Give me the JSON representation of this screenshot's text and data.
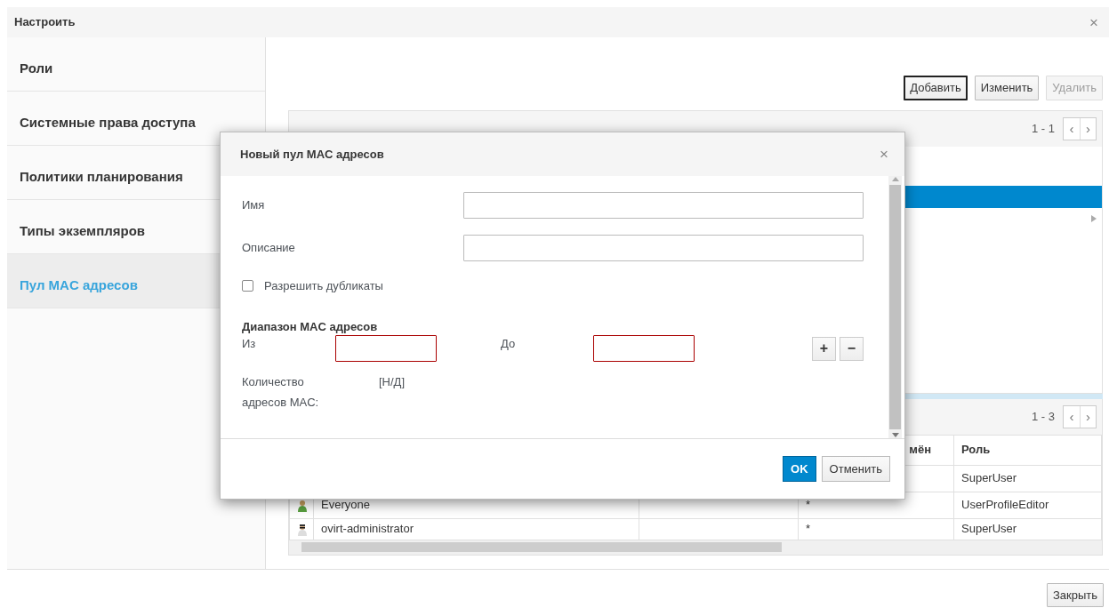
{
  "dialog": {
    "title": "Настроить",
    "close": "×"
  },
  "sidebar": {
    "items": [
      {
        "label": "Роли",
        "selected": false
      },
      {
        "label": "Системные права доступа",
        "selected": false
      },
      {
        "label": "Политики планирования",
        "selected": false
      },
      {
        "label": "Типы экземпляров",
        "selected": false
      },
      {
        "label": "Пул MAC адресов",
        "selected": true
      }
    ]
  },
  "toolbar": {
    "buttons": [
      {
        "label": "Добавить",
        "focused": true,
        "disabled": false
      },
      {
        "label": "Изменить",
        "focused": false,
        "disabled": false
      },
      {
        "label": "Удалить",
        "focused": false,
        "disabled": true
      }
    ]
  },
  "upper_table": {
    "pager": "1 - 1",
    "prev": "‹",
    "next": "›",
    "rows": [
      {
        "selected": true
      }
    ]
  },
  "lower_table": {
    "pager": "1 - 3",
    "prev": "‹",
    "next": "›",
    "columns": [
      "мён",
      "Роль"
    ],
    "rows": [
      {
        "role": "SuperUser"
      },
      {
        "kind": "group",
        "user": "Everyone",
        "column_4": "*",
        "role": "UserProfileEditor"
      },
      {
        "kind": "admin",
        "user": "ovirt-administrator",
        "column_4": "*",
        "role": "SuperUser"
      }
    ]
  },
  "modal": {
    "title": "Новый пул MAC адресов",
    "close": "×",
    "fields": [
      {
        "label": "Имя"
      },
      {
        "label": "Описание"
      }
    ],
    "allow_duplicates": {
      "label": "Разрешить дубликаты",
      "checked": false
    },
    "range": {
      "title": "Диапазон MAC адресов",
      "from": {
        "label": "Из",
        "invalid": true
      },
      "to": {
        "label": "До",
        "invalid": true
      },
      "add": "+",
      "remove": "−"
    },
    "count": {
      "label": "Количество адресов MAC:",
      "value": "[Н/Д]"
    },
    "buttons": [
      {
        "label": "OK",
        "kind": "primary"
      },
      {
        "label": "Отменить",
        "kind": "default"
      }
    ]
  },
  "footer": {
    "close": "Закрыть"
  }
}
